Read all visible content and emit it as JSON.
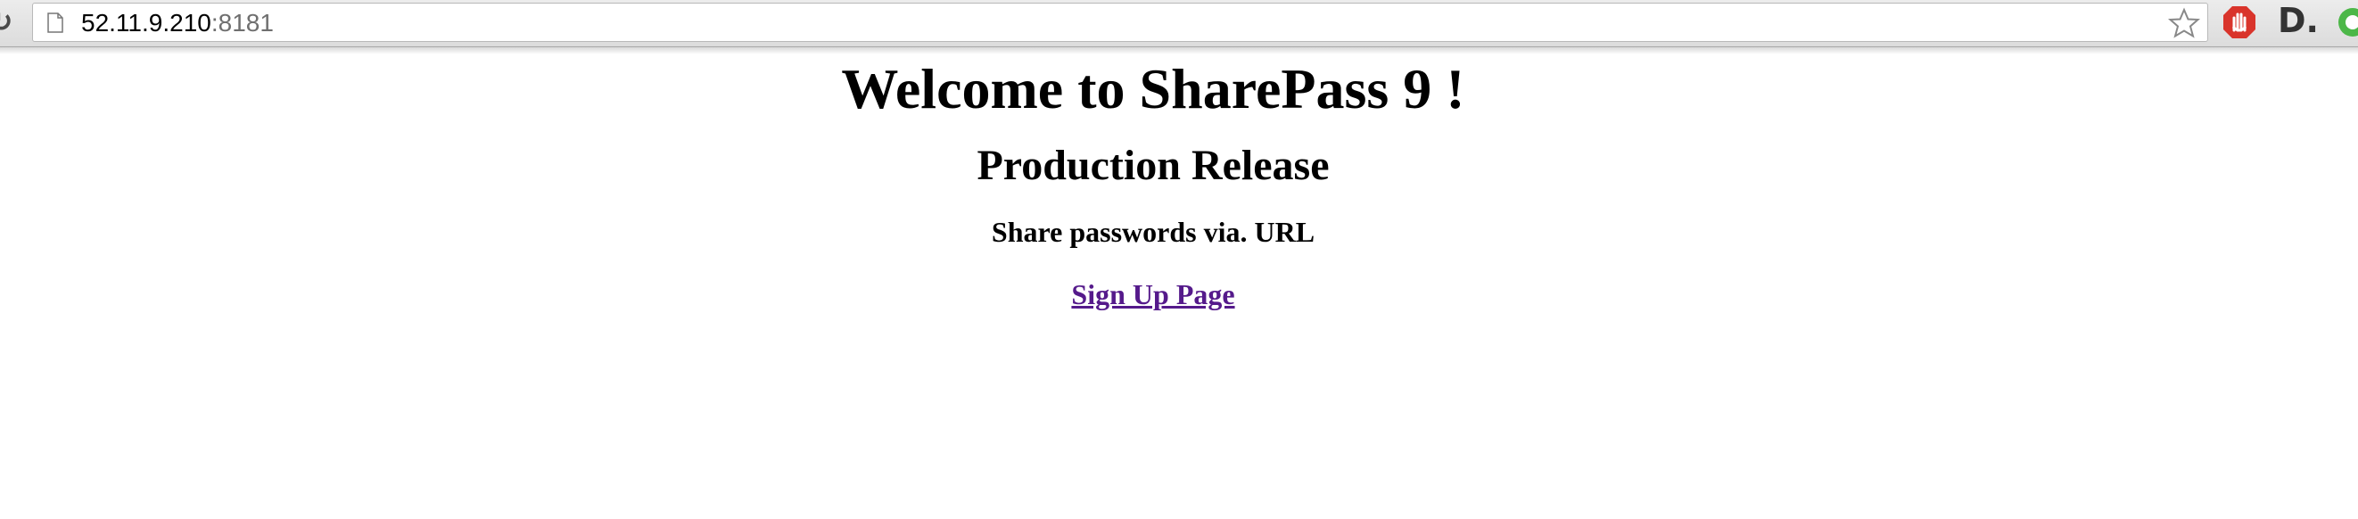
{
  "browser": {
    "url_host": "52.11.9.210",
    "url_port": ":8181",
    "extensions": [
      "stop-hand-icon",
      "d-icon",
      "green-circle-icon"
    ]
  },
  "page": {
    "title": "Welcome to SharePass 9 !",
    "subtitle": "Production Release",
    "tagline": "Share passwords via. URL",
    "signup_link": "Sign Up Page"
  },
  "colors": {
    "link_visited": "#551a8b",
    "text": "#000000",
    "background": "#ffffff"
  }
}
